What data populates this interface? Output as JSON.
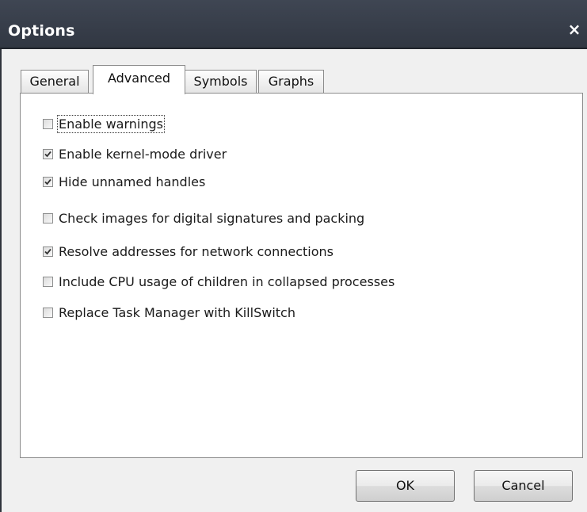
{
  "window": {
    "title": "Options",
    "close_label": "×"
  },
  "tabs": [
    {
      "label": "General",
      "active": false
    },
    {
      "label": "Advanced",
      "active": true
    },
    {
      "label": "Symbols",
      "active": false
    },
    {
      "label": "Graphs",
      "active": false
    }
  ],
  "options": [
    {
      "label": "Enable warnings",
      "checked": false
    },
    {
      "label": "Enable kernel-mode driver",
      "checked": true
    },
    {
      "label": "Hide unnamed handles",
      "checked": true
    },
    {
      "label": "Check images for digital signatures and packing",
      "checked": false
    },
    {
      "label": "Resolve addresses for network connections",
      "checked": true
    },
    {
      "label": "Include CPU usage of children in collapsed processes",
      "checked": false
    },
    {
      "label": "Replace Task Manager with KillSwitch",
      "checked": false
    }
  ],
  "buttons": {
    "ok_label": "OK",
    "cancel_label": "Cancel"
  },
  "icons": {
    "close": "close-icon",
    "check": "checkmark-icon"
  }
}
